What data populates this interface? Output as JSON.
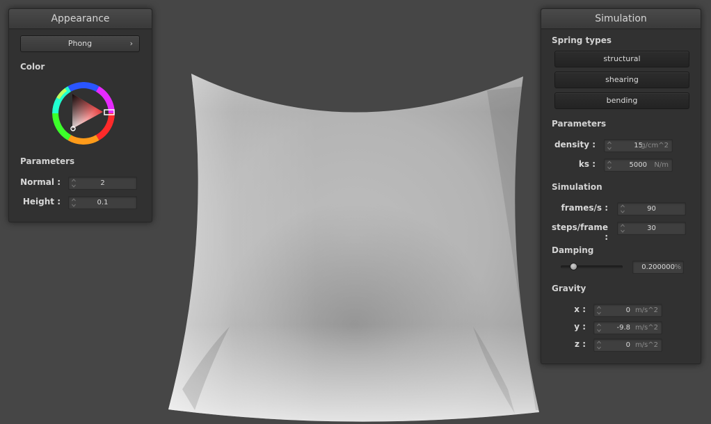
{
  "appearance": {
    "title": "Appearance",
    "shader": "Phong",
    "color_label": "Color",
    "color_indicator": "#e53c3c",
    "parameters_label": "Parameters",
    "normal": {
      "label": "Normal :",
      "value": "2"
    },
    "height": {
      "label": "Height :",
      "value": "0.1"
    }
  },
  "simulation": {
    "title": "Simulation",
    "spring_types_label": "Spring types",
    "spring_types": [
      "structural",
      "shearing",
      "bending"
    ],
    "parameters_label": "Parameters",
    "density": {
      "label": "density :",
      "value": "15",
      "unit": "g/cm^2"
    },
    "ks": {
      "label": "ks :",
      "value": "5000",
      "unit": "N/m"
    },
    "simulation_label": "Simulation",
    "frames_per_s": {
      "label": "frames/s :",
      "value": "90"
    },
    "steps_per_frame": {
      "label": "steps/frame :",
      "value": "30"
    },
    "damping_label": "Damping",
    "damping": {
      "value": "0.200000",
      "unit": "%",
      "fraction": 0.2
    },
    "gravity_label": "Gravity",
    "gravity": [
      {
        "label": "x :",
        "value": "0",
        "unit": "m/s^2"
      },
      {
        "label": "y :",
        "value": "-9.8",
        "unit": "m/s^2"
      },
      {
        "label": "z :",
        "value": "0",
        "unit": "m/s^2"
      }
    ]
  }
}
